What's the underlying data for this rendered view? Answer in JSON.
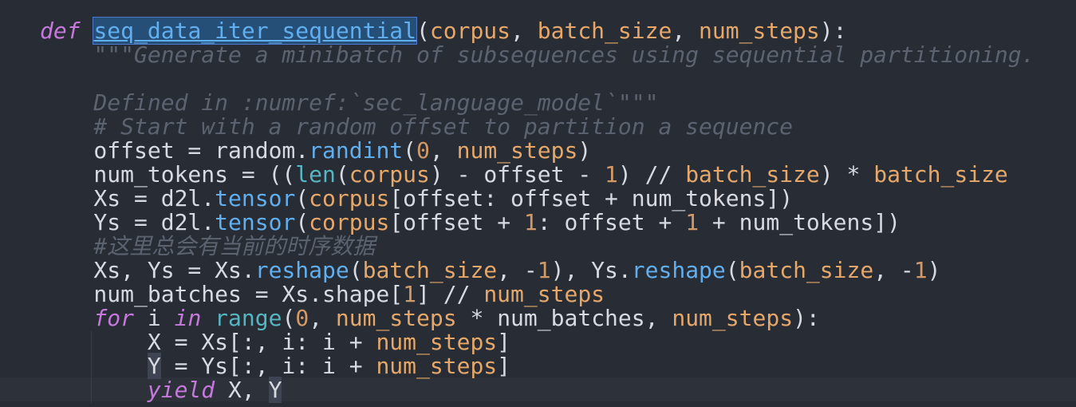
{
  "editor": {
    "lines": [
      {
        "tokens": [
          {
            "t": "def",
            "c": "kw"
          },
          {
            "t": " ",
            "c": "plain"
          },
          {
            "t": "seq_data_iter_sequential",
            "c": "fn-sel"
          },
          {
            "t": "(",
            "c": "plain"
          },
          {
            "t": "corpus",
            "c": "param"
          },
          {
            "t": ", ",
            "c": "plain"
          },
          {
            "t": "batch_size",
            "c": "param"
          },
          {
            "t": ", ",
            "c": "plain"
          },
          {
            "t": "num_steps",
            "c": "param"
          },
          {
            "t": "):",
            "c": "plain"
          }
        ]
      },
      {
        "tokens": [
          {
            "t": "    \"\"\"Generate a minibatch of subsequences using sequential partitioning.",
            "c": "doc"
          }
        ]
      },
      {
        "tokens": []
      },
      {
        "tokens": [
          {
            "t": "    Defined in :numref:`sec_language_model`\"\"\"",
            "c": "doc"
          }
        ]
      },
      {
        "tokens": [
          {
            "t": "    # Start with a random offset to partition a sequence",
            "c": "cmt"
          }
        ]
      },
      {
        "tokens": [
          {
            "t": "    offset = random.",
            "c": "plain"
          },
          {
            "t": "randint",
            "c": "fn"
          },
          {
            "t": "(",
            "c": "plain"
          },
          {
            "t": "0",
            "c": "num"
          },
          {
            "t": ", ",
            "c": "plain"
          },
          {
            "t": "num_steps",
            "c": "param"
          },
          {
            "t": ")",
            "c": "plain"
          }
        ]
      },
      {
        "tokens": [
          {
            "t": "    num_tokens = ((",
            "c": "plain"
          },
          {
            "t": "len",
            "c": "builtin"
          },
          {
            "t": "(",
            "c": "plain"
          },
          {
            "t": "corpus",
            "c": "param"
          },
          {
            "t": ") - offset - ",
            "c": "plain"
          },
          {
            "t": "1",
            "c": "num"
          },
          {
            "t": ") // ",
            "c": "plain"
          },
          {
            "t": "batch_size",
            "c": "param"
          },
          {
            "t": ") * ",
            "c": "plain"
          },
          {
            "t": "batch_size",
            "c": "param"
          }
        ]
      },
      {
        "tokens": [
          {
            "t": "    Xs = d2l.",
            "c": "plain"
          },
          {
            "t": "tensor",
            "c": "fn"
          },
          {
            "t": "(",
            "c": "plain"
          },
          {
            "t": "corpus",
            "c": "param"
          },
          {
            "t": "[offset: offset + num_tokens])",
            "c": "plain"
          }
        ]
      },
      {
        "tokens": [
          {
            "t": "    Ys = d2l.",
            "c": "plain"
          },
          {
            "t": "tensor",
            "c": "fn"
          },
          {
            "t": "(",
            "c": "plain"
          },
          {
            "t": "corpus",
            "c": "param"
          },
          {
            "t": "[offset + ",
            "c": "plain"
          },
          {
            "t": "1",
            "c": "num"
          },
          {
            "t": ": offset + ",
            "c": "plain"
          },
          {
            "t": "1",
            "c": "num"
          },
          {
            "t": " + num_tokens])",
            "c": "plain"
          }
        ]
      },
      {
        "tokens": [
          {
            "t": "    #这里总会有当前的时序数据",
            "c": "cmt"
          }
        ]
      },
      {
        "tokens": [
          {
            "t": "    Xs, Ys = Xs.",
            "c": "plain"
          },
          {
            "t": "reshape",
            "c": "fn"
          },
          {
            "t": "(",
            "c": "plain"
          },
          {
            "t": "batch_size",
            "c": "param"
          },
          {
            "t": ", -",
            "c": "plain"
          },
          {
            "t": "1",
            "c": "num"
          },
          {
            "t": "), Ys.",
            "c": "plain"
          },
          {
            "t": "reshape",
            "c": "fn"
          },
          {
            "t": "(",
            "c": "plain"
          },
          {
            "t": "batch_size",
            "c": "param"
          },
          {
            "t": ", -",
            "c": "plain"
          },
          {
            "t": "1",
            "c": "num"
          },
          {
            "t": ")",
            "c": "plain"
          }
        ]
      },
      {
        "tokens": [
          {
            "t": "    num_batches = Xs.shape[",
            "c": "plain"
          },
          {
            "t": "1",
            "c": "num"
          },
          {
            "t": "] // ",
            "c": "plain"
          },
          {
            "t": "num_steps",
            "c": "param"
          }
        ]
      },
      {
        "tokens": [
          {
            "t": "    ",
            "c": "plain"
          },
          {
            "t": "for",
            "c": "kw"
          },
          {
            "t": " i ",
            "c": "plain"
          },
          {
            "t": "in",
            "c": "kw"
          },
          {
            "t": " ",
            "c": "plain"
          },
          {
            "t": "range",
            "c": "builtin"
          },
          {
            "t": "(",
            "c": "plain"
          },
          {
            "t": "0",
            "c": "num"
          },
          {
            "t": ", ",
            "c": "plain"
          },
          {
            "t": "num_steps",
            "c": "param"
          },
          {
            "t": " * num_batches, ",
            "c": "plain"
          },
          {
            "t": "num_steps",
            "c": "param"
          },
          {
            "t": "):",
            "c": "plain"
          }
        ]
      },
      {
        "tokens": [
          {
            "t": "        X = Xs[:, i: i + ",
            "c": "plain"
          },
          {
            "t": "num_steps",
            "c": "param"
          },
          {
            "t": "]",
            "c": "plain"
          }
        ]
      },
      {
        "tokens": [
          {
            "t": "        ",
            "c": "plain"
          },
          {
            "t": "Y",
            "c": "plain hl"
          },
          {
            "t": " = Ys[:, i: i + ",
            "c": "plain"
          },
          {
            "t": "num_steps",
            "c": "param"
          },
          {
            "t": "]",
            "c": "plain"
          }
        ]
      },
      {
        "tokens": [
          {
            "t": "        ",
            "c": "plain"
          },
          {
            "t": "yield",
            "c": "kw"
          },
          {
            "t": " X, ",
            "c": "plain"
          },
          {
            "t": "Y",
            "c": "plain hl"
          }
        ]
      }
    ]
  }
}
